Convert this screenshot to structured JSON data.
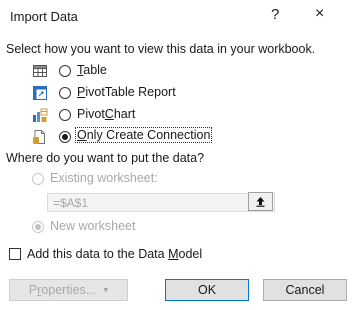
{
  "dialog": {
    "title": "Import Data",
    "help_glyph": "?",
    "close_glyph": "×",
    "view_prompt": "Select how you want to view this data in your workbook.",
    "view_options": [
      {
        "pre": "",
        "u": "T",
        "post": "able",
        "selected": false,
        "icon": "table-icon"
      },
      {
        "pre": "",
        "u": "P",
        "post": "ivotTable Report",
        "selected": false,
        "icon": "pivottable-icon"
      },
      {
        "pre": "Pivot",
        "u": "C",
        "post": "hart",
        "selected": false,
        "icon": "pivotchart-icon"
      },
      {
        "pre": "",
        "u": "O",
        "post": "nly Create Connection",
        "selected": true,
        "icon": "connection-icon"
      }
    ],
    "location_prompt": "Where do you want to put the data?",
    "existing_worksheet": {
      "label": "Existing worksheet:",
      "selected": false,
      "enabled": false
    },
    "cell_reference": {
      "value": "=$A$1",
      "enabled": false
    },
    "new_worksheet": {
      "label": "New worksheet",
      "selected": true,
      "enabled": false
    },
    "data_model": {
      "pre": "Add this data to the Data ",
      "u": "M",
      "post": "odel",
      "checked": false
    },
    "buttons": {
      "properties": {
        "pre": "P",
        "u": "r",
        "post": "operties...",
        "arrow": "▾",
        "enabled": false
      },
      "ok": "OK",
      "cancel": "Cancel"
    }
  }
}
